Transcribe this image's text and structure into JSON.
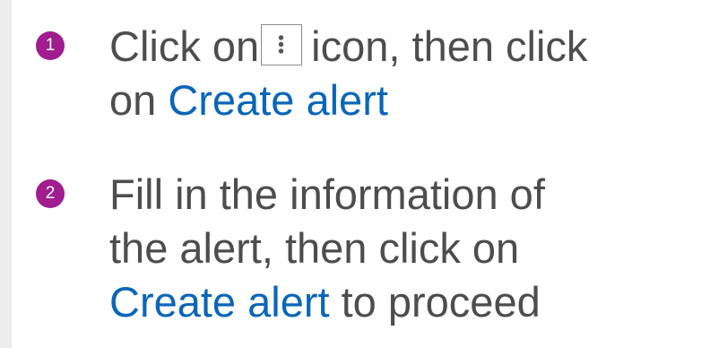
{
  "colors": {
    "badge": "#a01c8f",
    "text": "#4d4d4d",
    "link": "#0a66b8",
    "left_edge": "#ededed"
  },
  "steps": [
    {
      "number": "1",
      "line1_before_icon": "Click on",
      "icon": "kebab-menu-icon",
      "line1_after_icon": "icon, then click",
      "line2_prefix": "on",
      "line2_link": "Create alert"
    },
    {
      "number": "2",
      "line1": "Fill in the information of",
      "line2": "the alert, then click on",
      "line3_link": "Create alert",
      "line3_suffix": "to proceed"
    }
  ]
}
